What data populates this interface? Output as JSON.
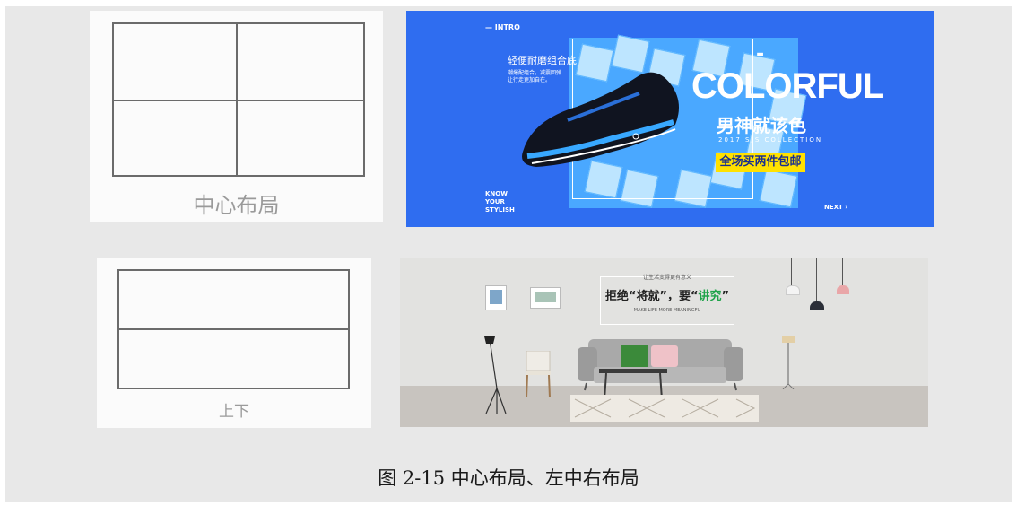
{
  "panels": {
    "center": {
      "label": "中心布局"
    },
    "topbottom": {
      "label": "上下"
    }
  },
  "banner1": {
    "intro": "— INTRO",
    "heading": "轻便耐磨组合底",
    "subtext_line1": "潮爆配组合，减震回弹",
    "subtext_line2": "让行走更加自在。",
    "dash": "-",
    "colorful": "COLORFUL",
    "slogan": "男神就该色",
    "collection": "2017 S/S COLLECTION",
    "cta": "全场买两件包邮",
    "know": "KNOW",
    "your": "YOUR",
    "stylish": "STYLISH",
    "next": "NEXT ›"
  },
  "banner2": {
    "small_title": "让生活变得更有意义",
    "headline_a": "拒绝“",
    "headline_b": "将就",
    "headline_c": "”，要“",
    "headline_d": "讲究",
    "headline_e": "”",
    "english": "MAKE LIFE MORE MEANINGFU"
  },
  "caption": "图 2-15 中心布局、左中右布局",
  "colors": {
    "banner1_bg": "#2f6df0",
    "cta_bg": "#ffe100",
    "accent_green": "#1fa34a"
  }
}
